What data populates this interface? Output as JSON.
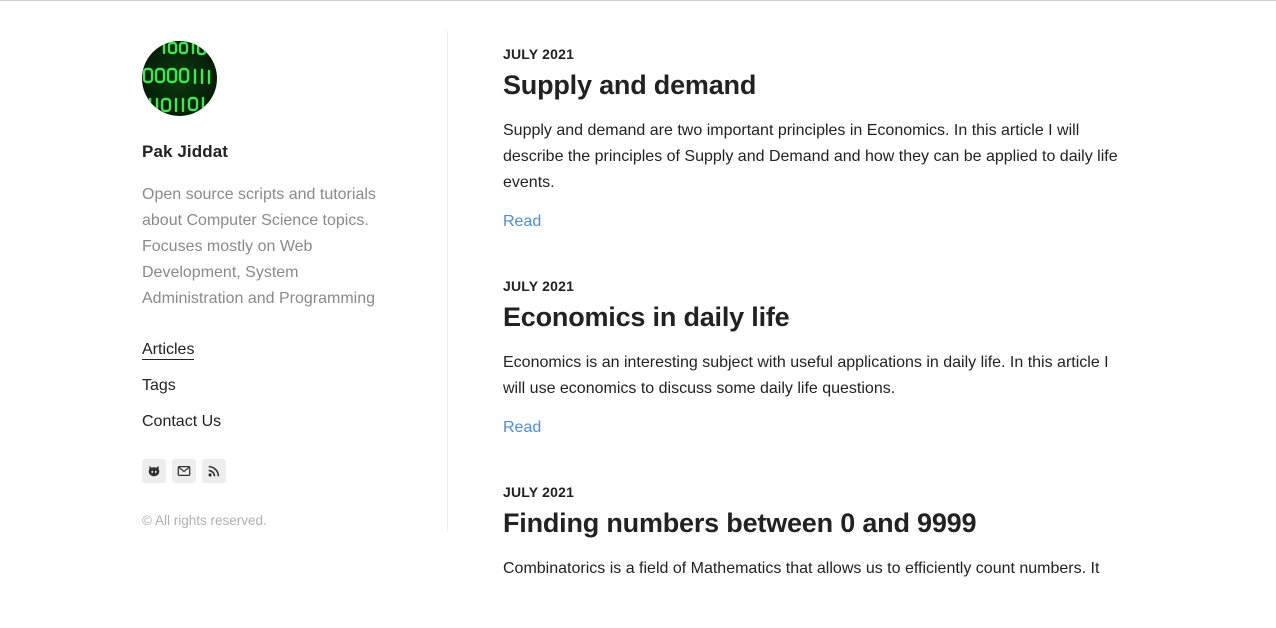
{
  "author": {
    "name": "Pak Jiddat",
    "bio": "Open source scripts and tutorials about Computer Science topics. Focuses mostly on Web Development, System Administration and Programming",
    "avatar_icon": "binary-code-avatar"
  },
  "nav": [
    {
      "label": "Articles",
      "active": true
    },
    {
      "label": "Tags",
      "active": false
    },
    {
      "label": "Contact Us",
      "active": false
    }
  ],
  "social": [
    {
      "icon": "github-icon"
    },
    {
      "icon": "email-icon"
    },
    {
      "icon": "rss-icon"
    }
  ],
  "footer": {
    "copyright": "© All rights reserved."
  },
  "posts": [
    {
      "date": "JULY 2021",
      "title": "Supply and demand",
      "excerpt": "Supply and demand are two important principles in Economics. In this article I will describe the principles of Supply and Demand and how they can be applied to daily life events.",
      "read_label": "Read"
    },
    {
      "date": "JULY 2021",
      "title": "Economics in daily life",
      "excerpt": "Economics is an interesting subject with useful applications in daily life. In this article I will use economics to discuss some daily life questions.",
      "read_label": "Read"
    },
    {
      "date": "JULY 2021",
      "title": "Finding numbers between 0 and 9999",
      "excerpt": "Combinatorics is a field of Mathematics that allows us to efficiently count numbers. It",
      "read_label": ""
    }
  ],
  "colors": {
    "accent": "#4a8de0",
    "text": "#222222",
    "muted": "#8a8a8a",
    "avatar_green": "#35e04a"
  }
}
